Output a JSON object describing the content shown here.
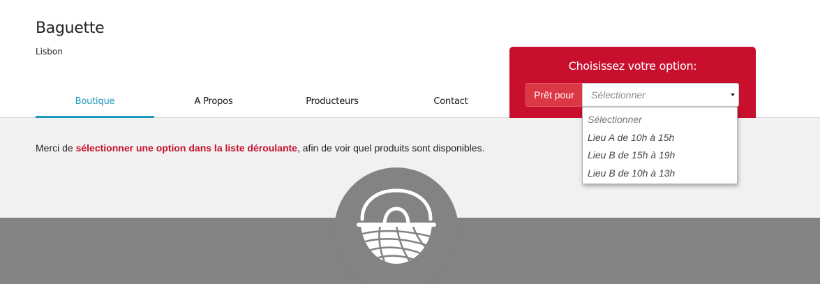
{
  "shop": {
    "name": "Baguette",
    "city": "Lisbon"
  },
  "nav": {
    "tabs": [
      {
        "label": "Boutique",
        "active": true
      },
      {
        "label": "A Propos",
        "active": false
      },
      {
        "label": "Producteurs",
        "active": false
      },
      {
        "label": "Contact",
        "active": false
      }
    ]
  },
  "option_panel": {
    "title": "Choisissez votre option:",
    "ready_label": "Prêt pour",
    "select": {
      "value": "Sélectionner",
      "options": [
        "Sélectionner",
        "Lieu A de 10h à 15h",
        "Lieu B de 15h à 19h",
        "Lieu B de 10h à 13h"
      ]
    }
  },
  "message": {
    "before": "Merci de ",
    "highlight": "sélectionner une option dans la liste déroulante",
    "after": ", afin de voir quel produits sont disponibles."
  },
  "icons": {
    "basket": "basket-icon"
  },
  "colors": {
    "accent_red": "#c8102e",
    "tab_active": "#1b9bbb",
    "footer_gray": "#838386"
  }
}
